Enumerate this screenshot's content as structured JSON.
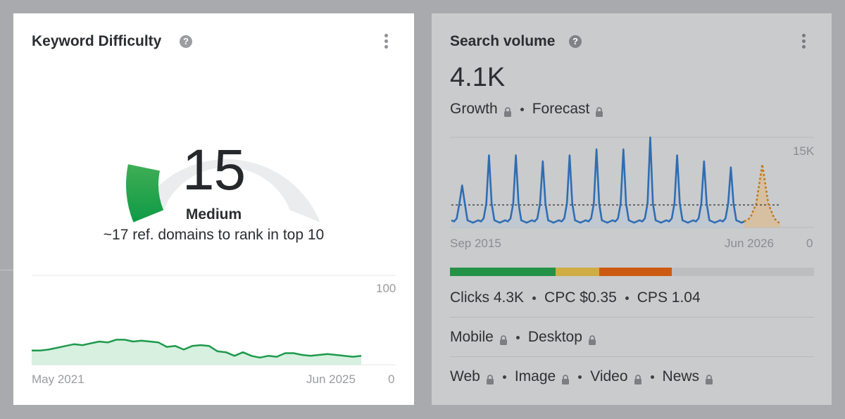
{
  "kd": {
    "title": "Keyword Difficulty",
    "score": "15",
    "level": "Medium",
    "subtitle": "~17 ref. domains to rank in top 10",
    "chart_max": "100",
    "chart_min": "0",
    "date_start": "May 2021",
    "date_end": "Jun 2025",
    "gauge_fraction": 0.15,
    "colors": {
      "gauge_fill": "#1f9d4a",
      "gauge_track": "#ebeced",
      "line": "#1e9a4c",
      "area": "#d7f0e0"
    }
  },
  "sv": {
    "title": "Search volume",
    "value": "4.1K",
    "growth_label": "Growth",
    "forecast_label": "Forecast",
    "chart_max": "15K",
    "chart_min": "0",
    "date_start": "Sep 2015",
    "date_end": "Jun 2026",
    "metrics": {
      "clicks": "Clicks 4.3K",
      "cpc": "CPC $0.35",
      "cps": "CPS 1.04"
    },
    "devices": {
      "mobile": "Mobile",
      "desktop": "Desktop"
    },
    "types": {
      "web": "Web",
      "image": "Image",
      "video": "Video",
      "news": "News"
    },
    "click_split": {
      "green": 0.29,
      "yellow": 0.12,
      "orange": 0.2,
      "gray": 0.39
    },
    "colors": {
      "line": "#2f6db3",
      "forecast": "#c07a1c",
      "green": "#239247",
      "yellow": "#cfad44",
      "orange": "#cc5a12",
      "gray": "#bdbebf"
    }
  },
  "icons": {
    "help": "help-icon",
    "menu": "kebab-menu-icon",
    "lock": "lock-icon"
  }
}
